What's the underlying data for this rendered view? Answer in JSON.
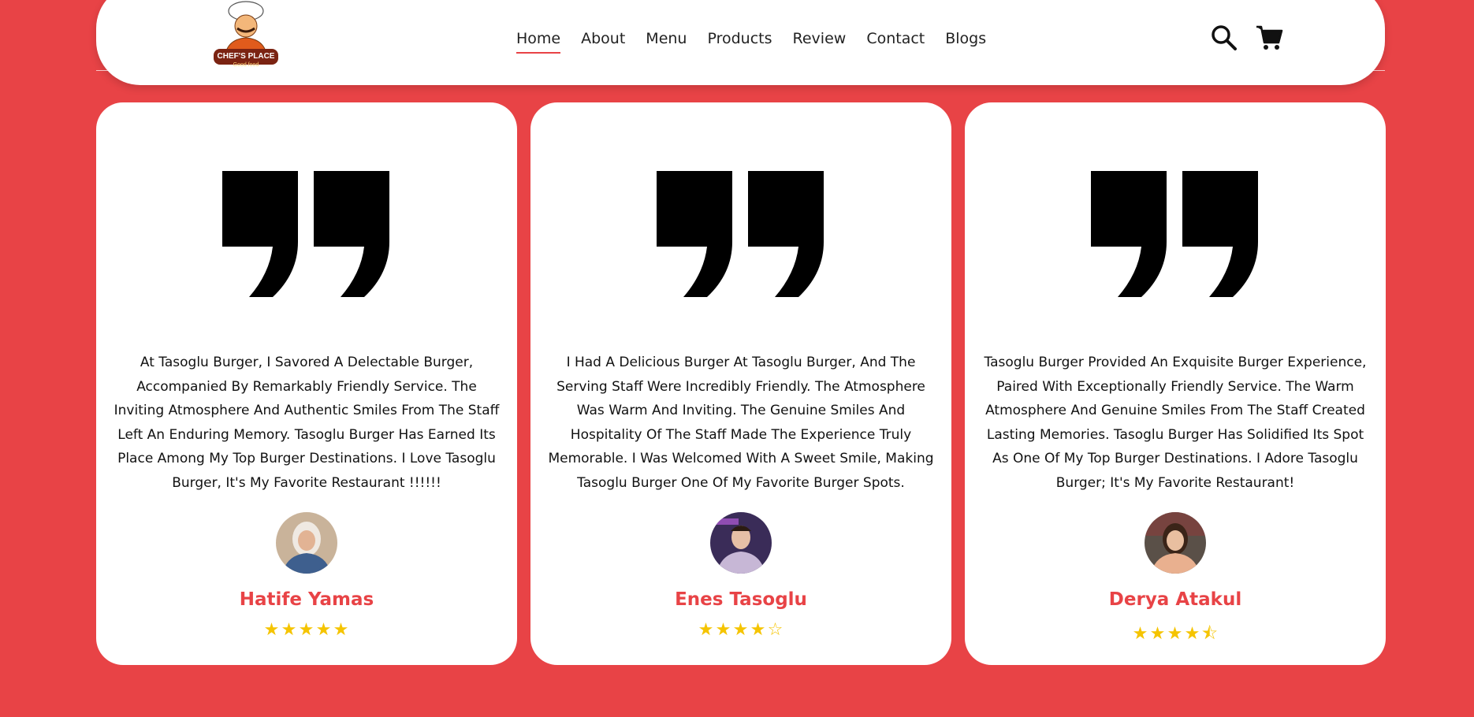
{
  "logo": {
    "line1": "CHEF'S PLACE",
    "line2": "Good food"
  },
  "nav": {
    "items": [
      "Home",
      "About",
      "Menu",
      "Products",
      "Review",
      "Contact",
      "Blogs"
    ],
    "active": "Home"
  },
  "icons": {
    "search": "search-icon",
    "cart": "cart-icon"
  },
  "colors": {
    "accent": "#e84346",
    "star": "#f5c400"
  },
  "reviews": [
    {
      "text": "At Tasoglu Burger, I Savored A Delectable Burger, Accompanied By Remarkably Friendly Service. The Inviting Atmosphere And Authentic Smiles From The Staff Left An Enduring Memory. Tasoglu Burger Has Earned Its Place Among My Top Burger Destinations. I Love Tasoglu Burger, It's My Favorite Restaurant !!!!!!",
      "name": "Hatife Yamas",
      "rating": 5
    },
    {
      "text": "I Had A Delicious Burger At Tasoglu Burger, And The Serving Staff Were Incredibly Friendly. The Atmosphere Was Warm And Inviting. The Genuine Smiles And Hospitality Of The Staff Made The Experience Truly Memorable. I Was Welcomed With A Sweet Smile, Making Tasoglu Burger One Of My Favorite Burger Spots.",
      "name": "Enes Tasoglu",
      "rating": 4
    },
    {
      "text": "Tasoglu Burger Provided An Exquisite Burger Experience, Paired With Exceptionally Friendly Service. The Warm Atmosphere And Genuine Smiles From The Staff Created Lasting Memories. Tasoglu Burger Has Solidified Its Spot As One Of My Top Burger Destinations. I Adore Tasoglu Burger; It's My Favorite Restaurant!",
      "name": "Derya Atakul",
      "rating": 4.5
    }
  ]
}
